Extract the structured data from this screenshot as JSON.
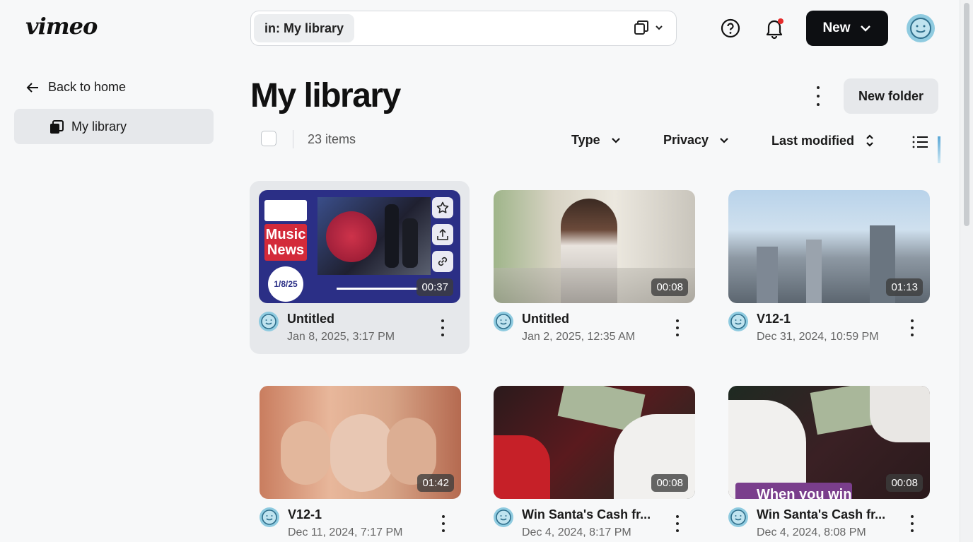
{
  "header": {
    "logo_text": "vimeo",
    "search_scope": "in: My library",
    "new_button_label": "New"
  },
  "sidebar": {
    "back_label": "Back to home",
    "items": [
      {
        "label": "My library"
      }
    ]
  },
  "main": {
    "title": "My library",
    "new_folder_label": "New folder",
    "item_count": "23 items",
    "filters": {
      "type": "Type",
      "privacy": "Privacy",
      "sort": "Last modified"
    }
  },
  "videos": [
    {
      "title": "Untitled",
      "date": "Jan 8, 2025, 3:17 PM",
      "duration": "00:37",
      "thumb_text_1": "Music",
      "thumb_text_2": "News",
      "thumb_date": "1/8/25"
    },
    {
      "title": "Untitled",
      "date": "Jan 2, 2025, 12:35 AM",
      "duration": "00:08"
    },
    {
      "title": "V12-1",
      "date": "Dec 31, 2024, 10:59 PM",
      "duration": "01:13"
    },
    {
      "title": "V12-1",
      "date": "Dec 11, 2024, 7:17 PM",
      "duration": "01:42"
    },
    {
      "title": "Win Santa's Cash fr...",
      "date": "Dec 4, 2024, 8:17 PM",
      "duration": "00:08"
    },
    {
      "title": "Win Santa's Cash fr...",
      "date": "Dec 4, 2024, 8:08 PM",
      "duration": "00:08",
      "overlay_text": "When you win"
    }
  ],
  "colors": {
    "accent": "#0d0f12",
    "avatar": "#8fcbe0",
    "notification_dot": "#e52b2b"
  },
  "icons": [
    "library-copy-icon",
    "chevron-down-icon",
    "help-icon",
    "bell-icon",
    "avatar-face-icon",
    "arrow-left-icon",
    "folder-stack-icon",
    "more-vertical-icon",
    "sort-icon",
    "list-view-icon",
    "star-icon",
    "upload-icon",
    "link-icon"
  ]
}
